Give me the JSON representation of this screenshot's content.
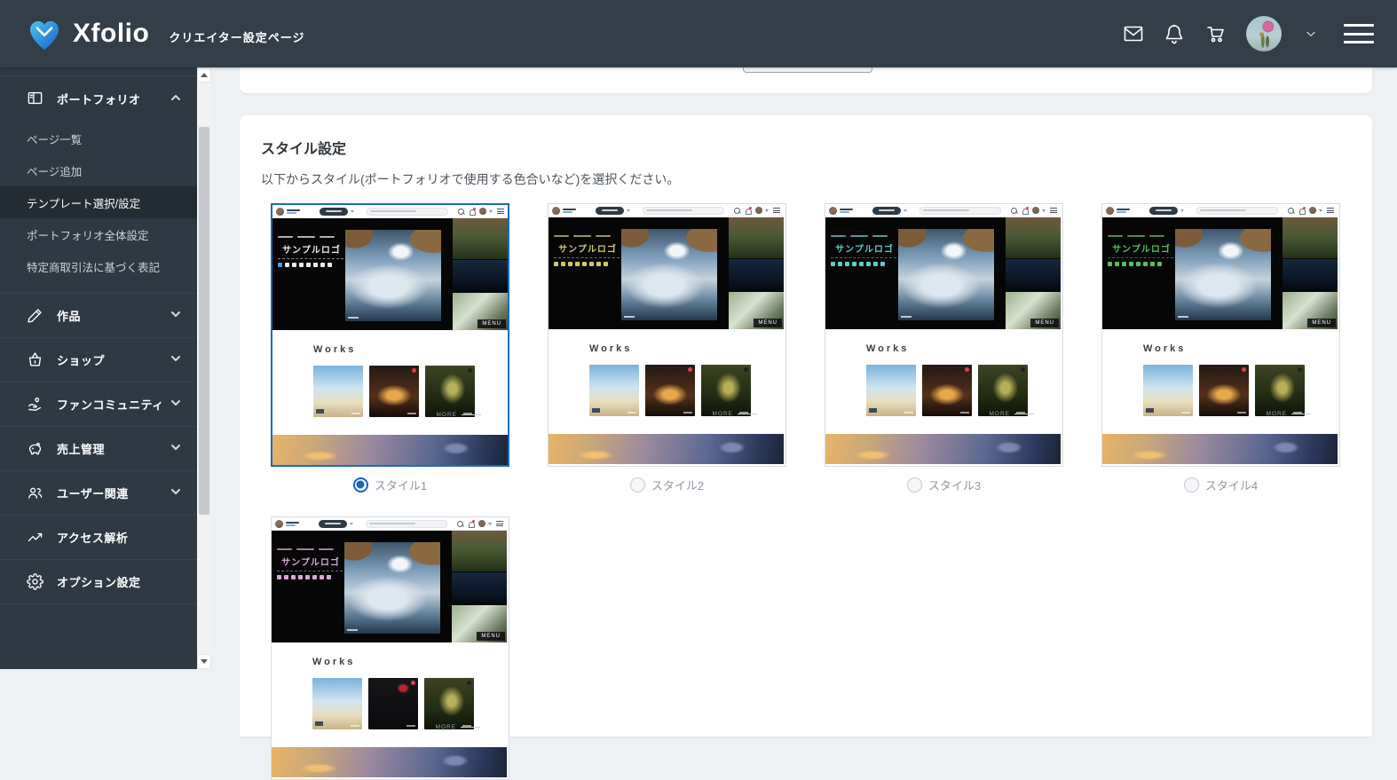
{
  "header": {
    "logo_text": "Xfolio",
    "page_title": "クリエイター設定ページ",
    "icons": [
      "mail-icon",
      "bell-icon",
      "cart-icon",
      "avatar",
      "chevron-down-icon",
      "menu-icon"
    ]
  },
  "sidebar": {
    "sections": [
      {
        "label": "ポートフォリオ",
        "icon": "portfolio-icon",
        "expanded": true,
        "children": [
          {
            "label": "ページ一覧",
            "active": false
          },
          {
            "label": "ページ追加",
            "active": false
          },
          {
            "label": "テンプレート選択/設定",
            "active": true
          },
          {
            "label": "ポートフォリオ全体設定",
            "active": false
          },
          {
            "label": "特定商取引法に基づく表記",
            "active": false
          }
        ]
      },
      {
        "label": "作品",
        "icon": "pencil-icon",
        "chevron": true
      },
      {
        "label": "ショップ",
        "icon": "shop-icon",
        "chevron": true
      },
      {
        "label": "ファンコミュニティ",
        "icon": "community-icon",
        "chevron": true
      },
      {
        "label": "売上管理",
        "icon": "piggybank-icon",
        "chevron": true
      },
      {
        "label": "ユーザー関連",
        "icon": "users-icon",
        "chevron": true
      },
      {
        "label": "アクセス解析",
        "icon": "analytics-icon",
        "chevron": false
      },
      {
        "label": "オプション設定",
        "icon": "gear-icon",
        "chevron": false
      }
    ]
  },
  "main": {
    "section_title": "スタイル設定",
    "section_description": "以下からスタイル(ポートフォリオで使用する色合いなど)を選択ください。",
    "styles": [
      {
        "label": "スタイル1",
        "selected": true,
        "accent": "#e9ebee",
        "first_icon": "#4a9ee0"
      },
      {
        "label": "スタイル2",
        "selected": false,
        "accent": "#ccce5e"
      },
      {
        "label": "スタイル3",
        "selected": false,
        "accent": "#5ad0c4"
      },
      {
        "label": "スタイル4",
        "selected": false,
        "accent": "#55c25d"
      },
      {
        "label": "",
        "selected": false,
        "accent": "#d9a8d4",
        "middle_card_dark": true
      }
    ],
    "preview": {
      "logo": "サンプルロゴ",
      "works_title": "Works",
      "menu_label": "MENU",
      "more_label": "MORE"
    }
  },
  "colors": {
    "radio_selected": "#1565c0",
    "selected_border": "#1b69c7",
    "header_bg": "#333e48",
    "sidebar_bg": "#2e3944"
  }
}
